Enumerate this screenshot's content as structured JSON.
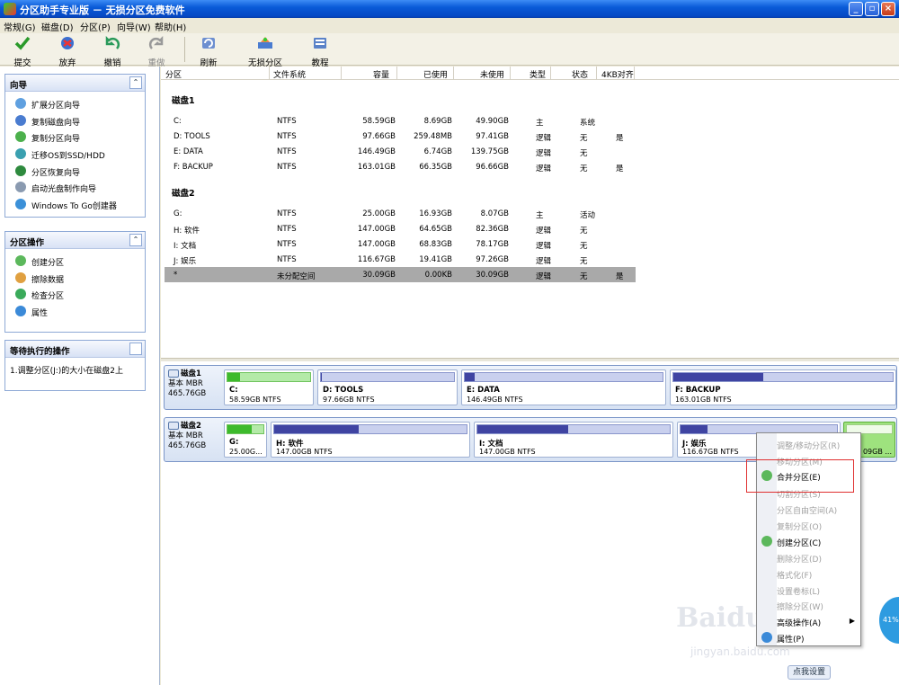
{
  "window": {
    "title": "分区助手专业版 － 无损分区免费软件",
    "min": "_",
    "max": "▫",
    "close": "×"
  },
  "menu": [
    "常规(G)",
    "磁盘(D)",
    "分区(P)",
    "向导(W)",
    "帮助(H)"
  ],
  "toolbar": {
    "commit": "提交",
    "discard": "放弃",
    "undo": "撤销",
    "redo": "重做",
    "refresh": "刷新",
    "lossless": "无损分区",
    "tutorial": "教程"
  },
  "wizard_panel": {
    "title": "向导",
    "items": [
      "扩展分区向导",
      "复制磁盘向导",
      "复制分区向导",
      "迁移OS到SSD/HDD",
      "分区恢复向导",
      "启动光盘制作向导",
      "Windows To Go创建器"
    ]
  },
  "partition_ops_panel": {
    "title": "分区操作",
    "items": [
      "创建分区",
      "擦除数据",
      "检查分区",
      "属性"
    ]
  },
  "pending_panel": {
    "title": "等待执行的操作",
    "items": [
      "1.调整分区(J:)的大小在磁盘2上"
    ]
  },
  "table": {
    "columns": [
      "分区",
      "文件系统",
      "容量",
      "已使用",
      "未使用",
      "类型",
      "状态",
      "4KB对齐"
    ],
    "disk1_label": "磁盘1",
    "disk2_label": "磁盘2",
    "disk1_rows": [
      [
        "C:",
        "NTFS",
        "58.59GB",
        "8.69GB",
        "49.90GB",
        "主",
        "系统",
        ""
      ],
      [
        "D: TOOLS",
        "NTFS",
        "97.66GB",
        "259.48MB",
        "97.41GB",
        "逻辑",
        "无",
        "是"
      ],
      [
        "E: DATA",
        "NTFS",
        "146.49GB",
        "6.74GB",
        "139.75GB",
        "逻辑",
        "无",
        ""
      ],
      [
        "F: BACKUP",
        "NTFS",
        "163.01GB",
        "66.35GB",
        "96.66GB",
        "逻辑",
        "无",
        "是"
      ]
    ],
    "disk2_rows": [
      [
        "G:",
        "NTFS",
        "25.00GB",
        "16.93GB",
        "8.07GB",
        "主",
        "活动",
        ""
      ],
      [
        "H: 软件",
        "NTFS",
        "147.00GB",
        "64.65GB",
        "82.36GB",
        "逻辑",
        "无",
        ""
      ],
      [
        "I: 文档",
        "NTFS",
        "147.00GB",
        "68.83GB",
        "78.17GB",
        "逻辑",
        "无",
        ""
      ],
      [
        "J: 娱乐",
        "NTFS",
        "116.67GB",
        "19.41GB",
        "97.26GB",
        "逻辑",
        "无",
        ""
      ],
      [
        "*",
        "未分配空间",
        "30.09GB",
        "0.00KB",
        "30.09GB",
        "逻辑",
        "无",
        "是"
      ]
    ]
  },
  "diskmap": {
    "disk1": {
      "name": "磁盘1",
      "type": "基本 MBR",
      "size": "465.76GB",
      "parts": [
        {
          "name": "C:",
          "info": "58.59GB NTFS",
          "used": 0.15
        },
        {
          "name": "D: TOOLS",
          "info": "97.66GB NTFS",
          "used": 0.01
        },
        {
          "name": "E: DATA",
          "info": "146.49GB NTFS",
          "used": 0.05
        },
        {
          "name": "F: BACKUP",
          "info": "163.01GB NTFS",
          "used": 0.41
        }
      ]
    },
    "disk2": {
      "name": "磁盘2",
      "type": "基本 MBR",
      "size": "465.76GB",
      "parts": [
        {
          "name": "G:",
          "info": "25.00G...",
          "used": 0.68
        },
        {
          "name": "H: 软件",
          "info": "147.00GB NTFS",
          "used": 0.44
        },
        {
          "name": "I: 文档",
          "info": "147.00GB NTFS",
          "used": 0.47
        },
        {
          "name": "J: 娱乐",
          "info": "116.67GB NTFS",
          "used": 0.17
        },
        {
          "name": "",
          "info": "09GB ...",
          "used": 0
        }
      ]
    }
  },
  "context_menu": [
    {
      "label": "调整/移动分区(R)",
      "enabled": false
    },
    {
      "label": "移动分区(M)",
      "enabled": false
    },
    {
      "label": "合并分区(E)",
      "enabled": true
    },
    {
      "label": "切割分区(S)",
      "enabled": false
    },
    {
      "label": "分区自由空间(A)",
      "enabled": false
    },
    {
      "label": "复制分区(O)",
      "enabled": false
    },
    {
      "label": "创建分区(C)",
      "enabled": true
    },
    {
      "label": "删除分区(D)",
      "enabled": false
    },
    {
      "label": "格式化(F)",
      "enabled": false
    },
    {
      "label": "设置卷标(L)",
      "enabled": false
    },
    {
      "label": "擦除分区(W)",
      "enabled": false
    },
    {
      "label": "高级操作(A)",
      "enabled": true
    },
    {
      "label": "属性(P)",
      "enabled": true
    }
  ],
  "tooltip_bubble": "点我设置",
  "progress_badge": "41%",
  "watermark": "Baidu经验",
  "watermark_url": "jingyan.baidu.com",
  "colors": {
    "used_bar": "#3f44a2",
    "primary_used": "#3dba2c",
    "unallocated": "#9ee27e",
    "selection": "#a9a9a9",
    "highlight_box": "#e03030"
  }
}
